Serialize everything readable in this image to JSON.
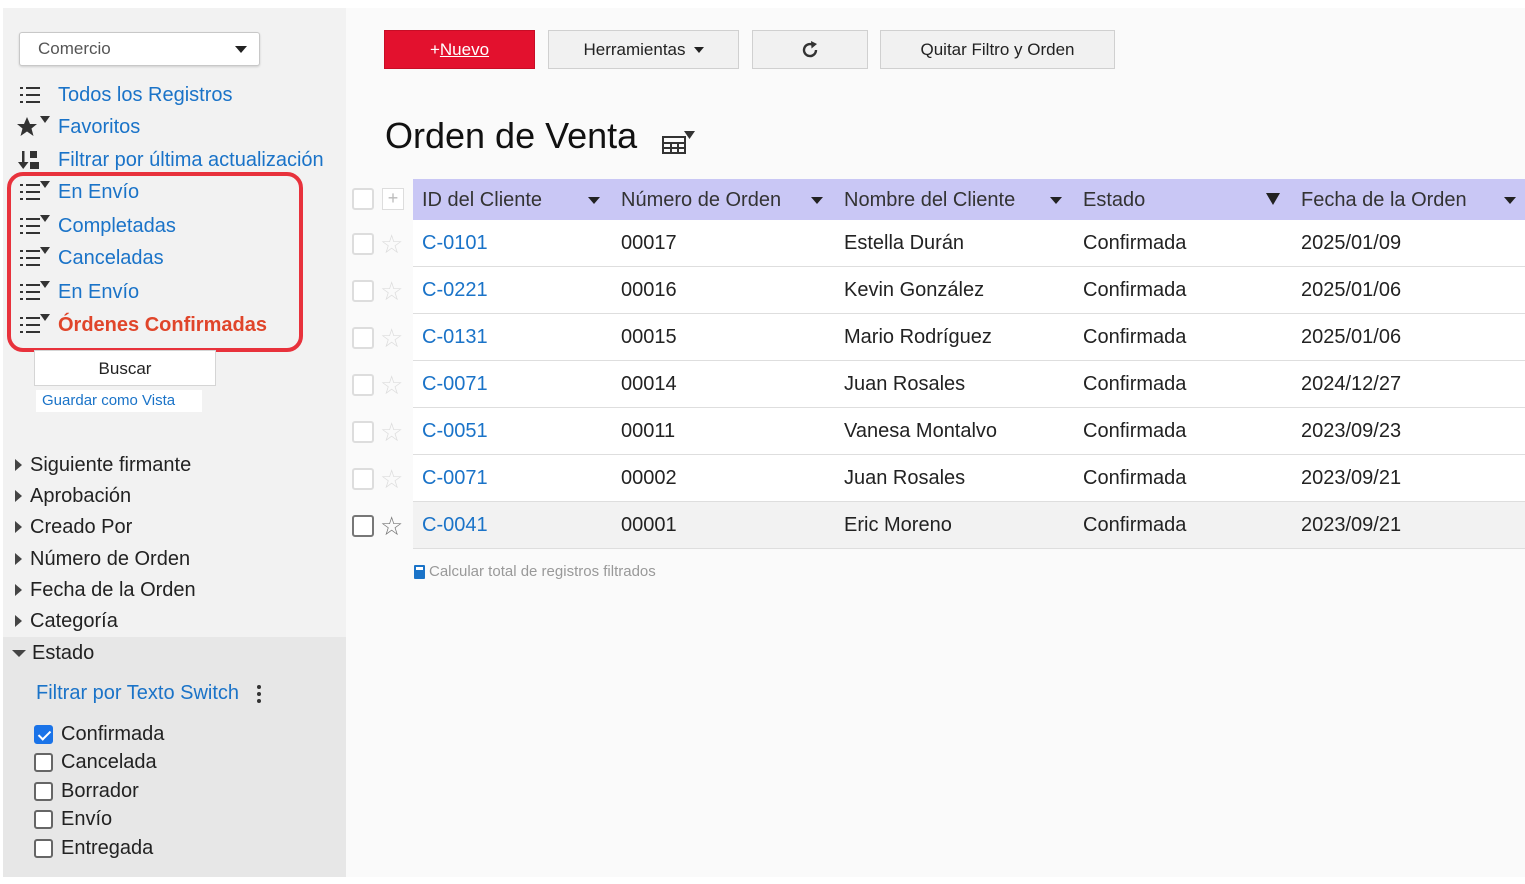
{
  "sidebar": {
    "app_select": "Comercio",
    "views": [
      {
        "label": "Todos los Registros",
        "icon": "list-icon"
      },
      {
        "label": "Favoritos",
        "icon": "star-filter-icon"
      },
      {
        "label": "Filtrar por última actualización",
        "icon": "sort-icon"
      },
      {
        "label": "En Envío",
        "icon": "list-filter-icon"
      },
      {
        "label": "Completadas",
        "icon": "list-filter-icon"
      },
      {
        "label": "Canceladas",
        "icon": "list-filter-icon"
      },
      {
        "label": "En Envío",
        "icon": "list-filter-icon"
      },
      {
        "label": "Órdenes Confirmadas",
        "icon": "list-filter-icon"
      }
    ],
    "search_label": "Buscar",
    "save_view_label": "Guardar como Vista",
    "fields": [
      "Siguiente firmante",
      "Aprobación",
      "Creado Por",
      "Número de Orden",
      "Fecha de la Orden",
      "Categoría"
    ],
    "estado": {
      "label": "Estado",
      "switch_label": "Filtrar por Texto Switch",
      "options": [
        {
          "label": "Confirmada",
          "checked": true
        },
        {
          "label": "Cancelada",
          "checked": false
        },
        {
          "label": "Borrador",
          "checked": false
        },
        {
          "label": "Envío",
          "checked": false
        },
        {
          "label": "Entregada",
          "checked": false
        }
      ]
    }
  },
  "toolbar": {
    "new_prefix": "+",
    "new_label": "Nuevo",
    "tools_label": "Herramientas",
    "refresh_icon": "refresh-icon",
    "clear_label": "Quitar Filtro y Orden"
  },
  "page": {
    "title": "Orden de Venta"
  },
  "table": {
    "columns": [
      "ID del Cliente",
      "Número de Orden",
      "Nombre del Cliente",
      "Estado",
      "Fecha de la Orden"
    ],
    "rows": [
      [
        "C-0101",
        "00017",
        "Estella Durán",
        "Confirmada",
        "2025/01/09"
      ],
      [
        "C-0221",
        "00016",
        "Kevin González",
        "Confirmada",
        "2025/01/06"
      ],
      [
        "C-0131",
        "00015",
        "Mario Rodríguez",
        "Confirmada",
        "2025/01/06"
      ],
      [
        "C-0071",
        "00014",
        "Juan Rosales",
        "Confirmada",
        "2024/12/27"
      ],
      [
        "C-0051",
        "00011",
        "Vanesa Montalvo",
        "Confirmada",
        "2023/09/23"
      ],
      [
        "C-0071",
        "00002",
        "Juan Rosales",
        "Confirmada",
        "2023/09/21"
      ],
      [
        "C-0041",
        "00001",
        "Eric Moreno",
        "Confirmada",
        "2023/09/21"
      ]
    ],
    "calc_label": "Calcular total de registros filtrados"
  },
  "colors": {
    "accent_red": "#e3112e",
    "link_blue": "#1a73c8",
    "header_purple": "#c9c7f5",
    "active_view": "#e0452a",
    "highlight": "#e8323c"
  }
}
